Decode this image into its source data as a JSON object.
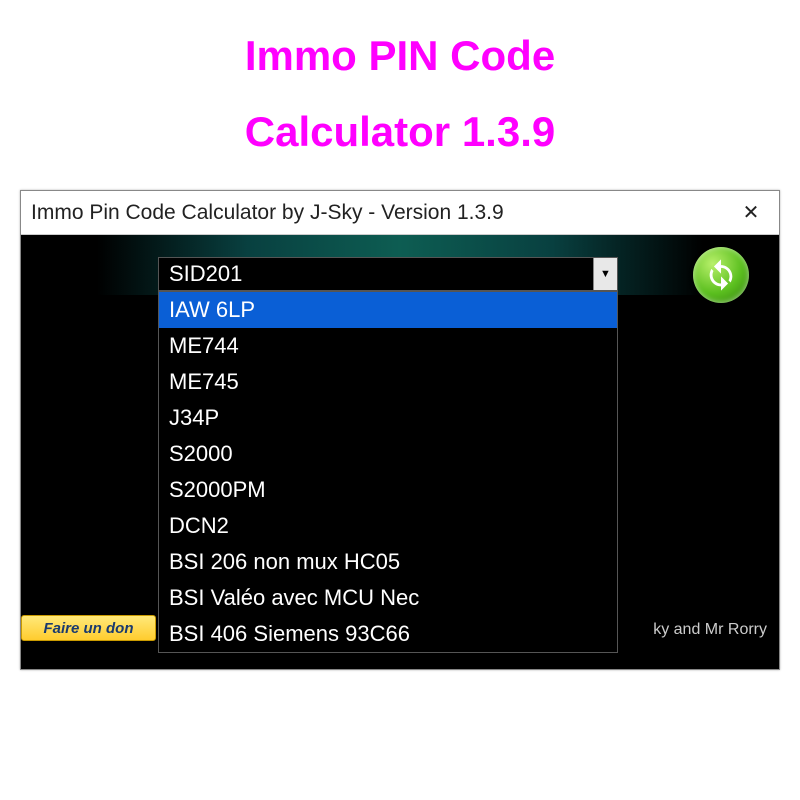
{
  "page_heading_line1": "Immo PIN Code",
  "page_heading_line2": "Calculator 1.3.9",
  "window": {
    "title": "Immo Pin Code Calculator by J-Sky  -  Version 1.3.9",
    "close_symbol": "✕"
  },
  "combo": {
    "selected": "SID201",
    "options": [
      "IAW 6LP",
      "ME744",
      "ME745",
      "J34P",
      "S2000",
      "S2000PM",
      "DCN2",
      "BSI 206 non mux HC05",
      "BSI Valéo avec MCU Nec",
      "BSI 406 Siemens 93C66"
    ],
    "highlighted_index": 0
  },
  "donate_label": "Faire un don",
  "credits_text": "ky and Mr Rorry"
}
